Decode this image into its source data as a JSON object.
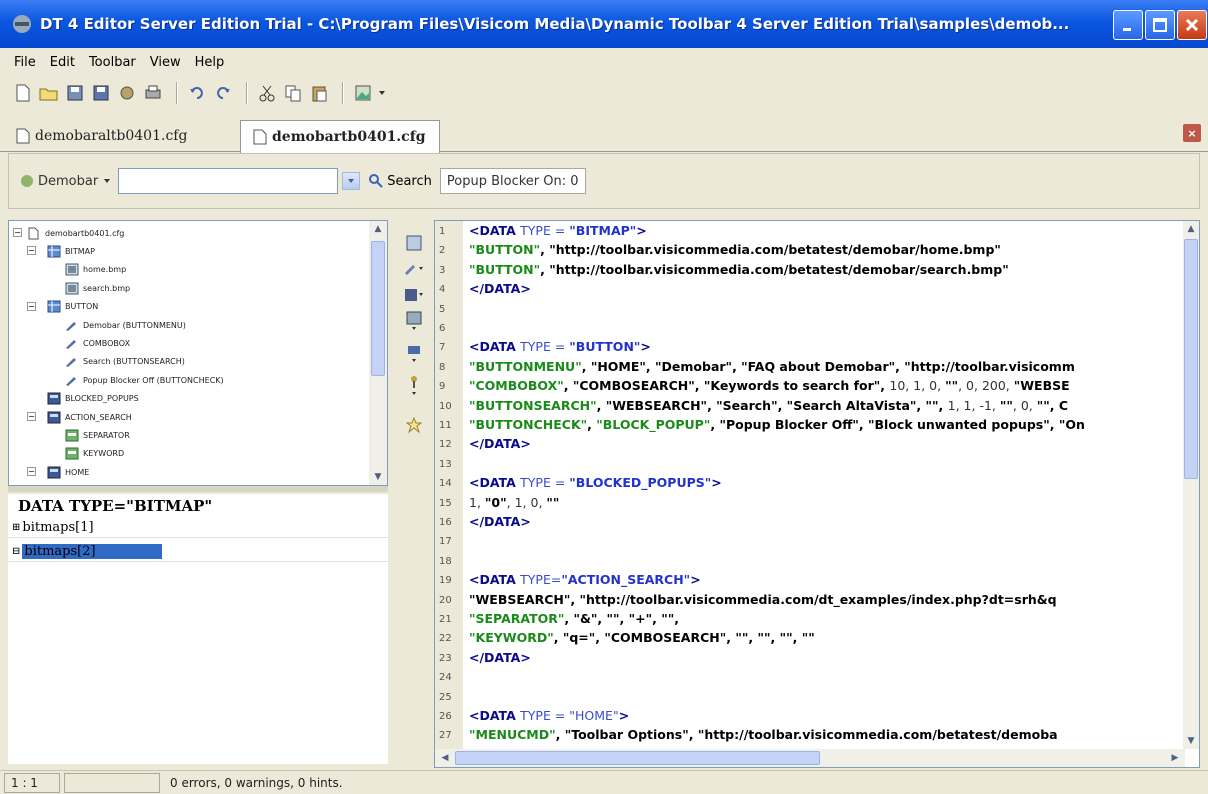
{
  "window": {
    "title": "DT 4 Editor Server Edition Trial - C:\\Program Files\\Visicom Media\\Dynamic Toolbar 4 Server Edition Trial\\samples\\demob..."
  },
  "menu": [
    "File",
    "Edit",
    "Toolbar",
    "View",
    "Help"
  ],
  "tabs": [
    {
      "label": "demobaraltb0401.cfg",
      "active": false
    },
    {
      "label": "demobartb0401.cfg",
      "active": true
    }
  ],
  "preview": {
    "demobar_label": "Demobar",
    "search_label": "Search",
    "popup_label": "Popup Blocker On: 0"
  },
  "tree": [
    {
      "label": "demobartb0401.cfg",
      "level": 0,
      "icon": "file-icon",
      "expander": "−"
    },
    {
      "label": "BITMAP",
      "level": 1,
      "icon": "folder-grid-icon",
      "expander": "−"
    },
    {
      "label": "home.bmp",
      "level": 2,
      "icon": "bitmap-icon",
      "expander": ""
    },
    {
      "label": "search.bmp",
      "level": 2,
      "icon": "bitmap-icon",
      "expander": ""
    },
    {
      "label": "BUTTON",
      "level": 1,
      "icon": "folder-grid-icon",
      "expander": "−"
    },
    {
      "label": "Demobar  (BUTTONMENU)",
      "level": 2,
      "icon": "button-icon",
      "expander": ""
    },
    {
      "label": "COMBOBOX",
      "level": 2,
      "icon": "button-icon",
      "expander": ""
    },
    {
      "label": "Search  (BUTTONSEARCH)",
      "level": 2,
      "icon": "button-icon",
      "expander": ""
    },
    {
      "label": "Popup Blocker Off  (BUTTONCHECK)",
      "level": 2,
      "icon": "button-icon",
      "expander": ""
    },
    {
      "label": "BLOCKED_POPUPS",
      "level": 1,
      "icon": "data-icon",
      "expander": ""
    },
    {
      "label": "ACTION_SEARCH",
      "level": 1,
      "icon": "data-icon",
      "expander": "−"
    },
    {
      "label": "SEPARATOR",
      "level": 2,
      "icon": "green-item-icon",
      "expander": ""
    },
    {
      "label": "KEYWORD",
      "level": 2,
      "icon": "green-item-icon",
      "expander": ""
    },
    {
      "label": "HOME",
      "level": 1,
      "icon": "data-icon",
      "expander": "−"
    }
  ],
  "properties": {
    "header": "DATA TYPE=\"BITMAP\"",
    "rows": [
      {
        "label": "bitmaps[1]",
        "selected": false
      },
      {
        "label": "bitmaps[2]",
        "selected": true
      }
    ]
  },
  "editor": {
    "line_numbers": [
      "1",
      "2",
      "3",
      "4",
      "5",
      "6",
      "7",
      "8",
      "9",
      "10",
      "11",
      "12",
      "13",
      "14",
      "15",
      "16",
      "17",
      "18",
      "19",
      "20",
      "21",
      "22",
      "23",
      "24",
      "25",
      "26",
      "27"
    ],
    "lines": [
      [
        {
          "t": "<DATA ",
          "c": "tag"
        },
        {
          "t": "TYPE = ",
          "c": "attr"
        },
        {
          "t": "\"BITMAP\"",
          "c": "blu"
        },
        {
          "t": ">",
          "c": "tag"
        }
      ],
      [
        {
          "t": "\"BUTTON\"",
          "c": "grn"
        },
        {
          "t": ", \"http://toolbar.visicommedia.com/betatest/demobar/home.bmp\"",
          "c": "str"
        }
      ],
      [
        {
          "t": "\"BUTTON\"",
          "c": "grn"
        },
        {
          "t": ", \"http://toolbar.visicommedia.com/betatest/demobar/search.bmp\"",
          "c": "str"
        }
      ],
      [
        {
          "t": "</DATA>",
          "c": "tag"
        }
      ],
      [],
      [],
      [
        {
          "t": "<DATA ",
          "c": "tag"
        },
        {
          "t": "TYPE = ",
          "c": "attr"
        },
        {
          "t": "\"BUTTON\"",
          "c": "blu"
        },
        {
          "t": ">",
          "c": "tag"
        }
      ],
      [
        {
          "t": "\"BUTTONMENU\"",
          "c": "grn"
        },
        {
          "t": ", \"HOME\", \"Demobar\", \"FAQ about Demobar\", \"http://toolbar.visicomm",
          "c": "str"
        }
      ],
      [
        {
          "t": "\"COMBOBOX\"",
          "c": "grn"
        },
        {
          "t": ", \"COMBOSEARCH\", \"Keywords to search for\", ",
          "c": "str"
        },
        {
          "t": "10, 1, 0, ",
          "c": "num"
        },
        {
          "t": "\"\"",
          "c": "str"
        },
        {
          "t": ", 0, 200, ",
          "c": "num"
        },
        {
          "t": "\"WEBSE",
          "c": "str"
        }
      ],
      [
        {
          "t": "\"BUTTONSEARCH\"",
          "c": "grn"
        },
        {
          "t": ", \"WEBSEARCH\", \"Search\", \"Search AltaVista\", \"\", ",
          "c": "str"
        },
        {
          "t": "1, 1, -1, ",
          "c": "num"
        },
        {
          "t": "\"\"",
          "c": "str"
        },
        {
          "t": ", 0, ",
          "c": "num"
        },
        {
          "t": "\"\", C",
          "c": "str"
        }
      ],
      [
        {
          "t": "\"BUTTONCHECK\"",
          "c": "grn"
        },
        {
          "t": ", ",
          "c": "str"
        },
        {
          "t": "\"BLOCK_POPUP\"",
          "c": "grn"
        },
        {
          "t": ", \"Popup Blocker Off\", \"Block unwanted popups\", \"On",
          "c": "str"
        }
      ],
      [
        {
          "t": "</DATA>",
          "c": "tag"
        }
      ],
      [],
      [
        {
          "t": "<DATA ",
          "c": "tag"
        },
        {
          "t": "TYPE = ",
          "c": "attr"
        },
        {
          "t": "\"BLOCKED_POPUPS\"",
          "c": "blu"
        },
        {
          "t": ">",
          "c": "tag"
        }
      ],
      [
        {
          "t": "1, ",
          "c": "num"
        },
        {
          "t": "\"0\"",
          "c": "str"
        },
        {
          "t": ", 1, 0, ",
          "c": "num"
        },
        {
          "t": "\"\"",
          "c": "str"
        }
      ],
      [
        {
          "t": "</DATA>",
          "c": "tag"
        }
      ],
      [],
      [],
      [
        {
          "t": "<DATA ",
          "c": "tag"
        },
        {
          "t": "TYPE=",
          "c": "attr"
        },
        {
          "t": "\"ACTION_SEARCH\"",
          "c": "blu"
        },
        {
          "t": ">",
          "c": "tag"
        }
      ],
      [
        {
          "t": "\"WEBSEARCH\", \"http://toolbar.visicommedia.com/dt_examples/index.php?dt=srh&q",
          "c": "str"
        }
      ],
      [
        {
          "t": "\"SEPARATOR\"",
          "c": "grn"
        },
        {
          "t": ", \"&\", \"\", \"+\", \"\",",
          "c": "str"
        }
      ],
      [
        {
          "t": "\"KEYWORD\"",
          "c": "grn"
        },
        {
          "t": ", \"q=\", \"COMBOSEARCH\", \"\", \"\", \"\", \"\"",
          "c": "str"
        }
      ],
      [
        {
          "t": "</DATA>",
          "c": "tag"
        }
      ],
      [],
      [],
      [
        {
          "t": "<DATA ",
          "c": "tag"
        },
        {
          "t": "TYPE = ",
          "c": "attr"
        },
        {
          "t": "\"HOME\"",
          "c": "attr"
        },
        {
          "t": ">",
          "c": "tag"
        }
      ],
      [
        {
          "t": "\"MENUCMD\"",
          "c": "grn"
        },
        {
          "t": ", \"Toolbar Options\", \"http://toolbar.visicommedia.com/betatest/demoba",
          "c": "str"
        }
      ]
    ]
  },
  "status": {
    "position": "1 : 1",
    "message": "0 errors, 0 warnings, 0 hints."
  },
  "colors": {
    "titlebar": "#0a56e0",
    "selection": "#316ac5",
    "tag": "#0a0a8c",
    "keyword_green": "#1a8a1a",
    "value_blue": "#2233cc"
  }
}
